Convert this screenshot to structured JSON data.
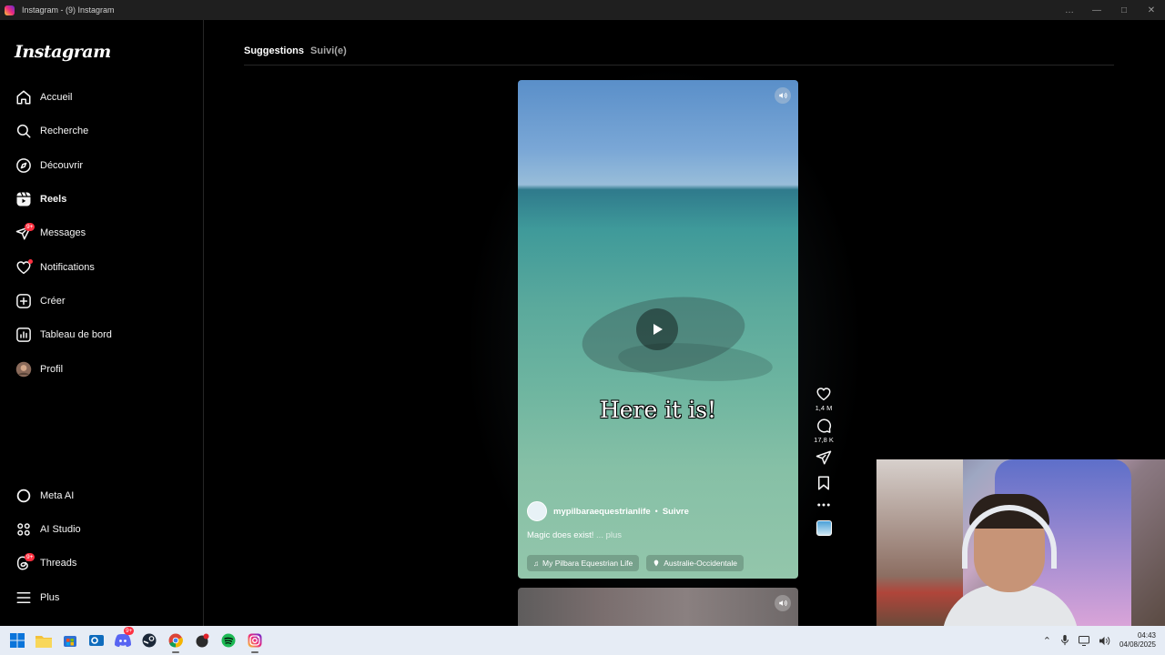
{
  "window": {
    "title": "Instagram - (9) Instagram",
    "controls": [
      "…",
      "—",
      "□",
      "✕"
    ]
  },
  "sidebar": {
    "logo": "Instagram",
    "items": [
      {
        "label": "Accueil",
        "icon": "home-icon"
      },
      {
        "label": "Recherche",
        "icon": "search-icon"
      },
      {
        "label": "Découvrir",
        "icon": "compass-icon"
      },
      {
        "label": "Reels",
        "icon": "reels-icon",
        "active": true
      },
      {
        "label": "Messages",
        "icon": "messenger-icon",
        "badge": "9+"
      },
      {
        "label": "Notifications",
        "icon": "heart-icon",
        "dot": true
      },
      {
        "label": "Créer",
        "icon": "plus-square-icon"
      },
      {
        "label": "Tableau de bord",
        "icon": "dashboard-icon"
      },
      {
        "label": "Profil",
        "icon": "avatar"
      }
    ],
    "bottom_items": [
      {
        "label": "Meta AI",
        "icon": "meta-ai-icon"
      },
      {
        "label": "AI Studio",
        "icon": "ai-studio-icon"
      },
      {
        "label": "Threads",
        "icon": "threads-icon",
        "badge": "9+"
      },
      {
        "label": "Plus",
        "icon": "menu-icon"
      }
    ]
  },
  "tabs": {
    "suggestions": "Suggestions",
    "following": "Suivi(e)"
  },
  "reel": {
    "overlay_caption": "Here it is!",
    "author": "mypilbaraequestrianlife",
    "separator": "•",
    "follow": "Suivre",
    "description": "Magic does exist!",
    "more": "... plus",
    "audio": "My Pilbara Equestrian Life",
    "location": "Australie-Occidentale",
    "likes": "1,4 M",
    "comments": "17,8 K"
  },
  "taskbar": {
    "apps": [
      "windows-start-icon",
      "file-explorer-icon",
      "store-icon",
      "outlook-icon",
      "discord-icon",
      "steam-icon",
      "chrome-icon",
      "app-icon",
      "spotify-icon",
      "instagram-icon"
    ],
    "discord_badge": "9+",
    "time": "04:43",
    "date": "04/08/2025"
  },
  "colors": {
    "background": "#000000",
    "badge": "#ff3040",
    "taskbar": "#e6ecf5"
  }
}
